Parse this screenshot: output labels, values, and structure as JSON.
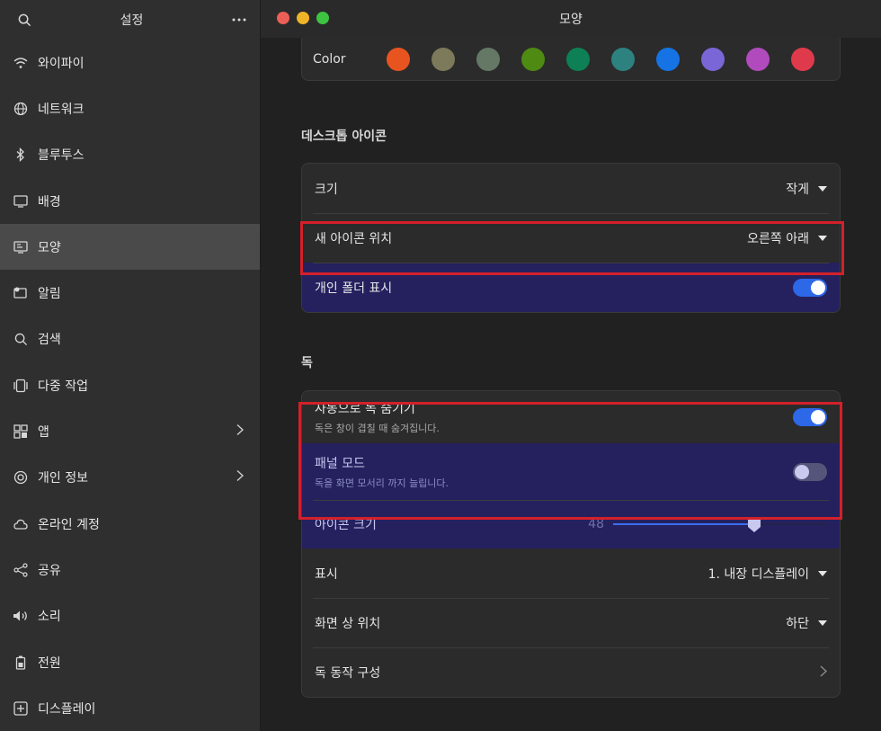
{
  "sidebar": {
    "title": "설정",
    "search_icon": "search-icon",
    "more_icon": "more-icon",
    "items": [
      {
        "label": "와이파이",
        "icon": "wifi-icon"
      },
      {
        "label": "네트워크",
        "icon": "globe-icon"
      },
      {
        "label": "블루투스",
        "icon": "bluetooth-icon"
      },
      {
        "label": "배경",
        "icon": "monitor-icon"
      },
      {
        "label": "모양",
        "icon": "appearance-icon",
        "active": true
      },
      {
        "label": "알림",
        "icon": "notification-icon"
      },
      {
        "label": "검색",
        "icon": "search-icon"
      },
      {
        "label": "다중 작업",
        "icon": "multitask-icon"
      },
      {
        "label": "앱",
        "icon": "apps-grid-icon",
        "chevron": true
      },
      {
        "label": "개인 정보",
        "icon": "privacy-icon",
        "chevron": true
      },
      {
        "label": "온라인 계정",
        "icon": "cloud-icon"
      },
      {
        "label": "공유",
        "icon": "share-icon"
      },
      {
        "label": "소리",
        "icon": "speaker-icon"
      },
      {
        "label": "전원",
        "icon": "battery-icon"
      },
      {
        "label": "디스플레이",
        "icon": "display-icon"
      }
    ]
  },
  "window": {
    "title": "모양",
    "traffic_colors": [
      "#ec5f57",
      "#f0b429",
      "#3dc441"
    ]
  },
  "color_section": {
    "label": "Color",
    "swatches": [
      "#e8541f",
      "#7d7a5b",
      "#657866",
      "#4f8a12",
      "#0e8055",
      "#2d8280",
      "#1573e3",
      "#7a66d6",
      "#b14bbd",
      "#df3a4b"
    ]
  },
  "desktop_icons": {
    "title": "데스크톱 아이콘",
    "size_label": "크기",
    "size_value": "작게",
    "new_icon_pos_label": "새 아이콘 위치",
    "new_icon_pos_value": "오른쪽 아래",
    "show_home_label": "개인 폴더 표시",
    "show_home_on": true
  },
  "dock": {
    "title": "독",
    "autohide_label": "자동으로 독 숨기기",
    "autohide_sub": "독은 창이 겹칠 때 숨겨집니다.",
    "autohide_on": true,
    "panel_mode_label": "패널 모드",
    "panel_mode_sub": "독을 화면 모서리 까지 늘립니다.",
    "panel_mode_on": false,
    "icon_size_label": "아이콘 크기",
    "icon_size_value": "48",
    "icon_size_fraction": 0.66,
    "display_label": "표시",
    "display_value": "1. 내장 디스플레이",
    "position_label": "화면 상 위치",
    "position_value": "하단",
    "behavior_label": "독 동작 구성"
  }
}
